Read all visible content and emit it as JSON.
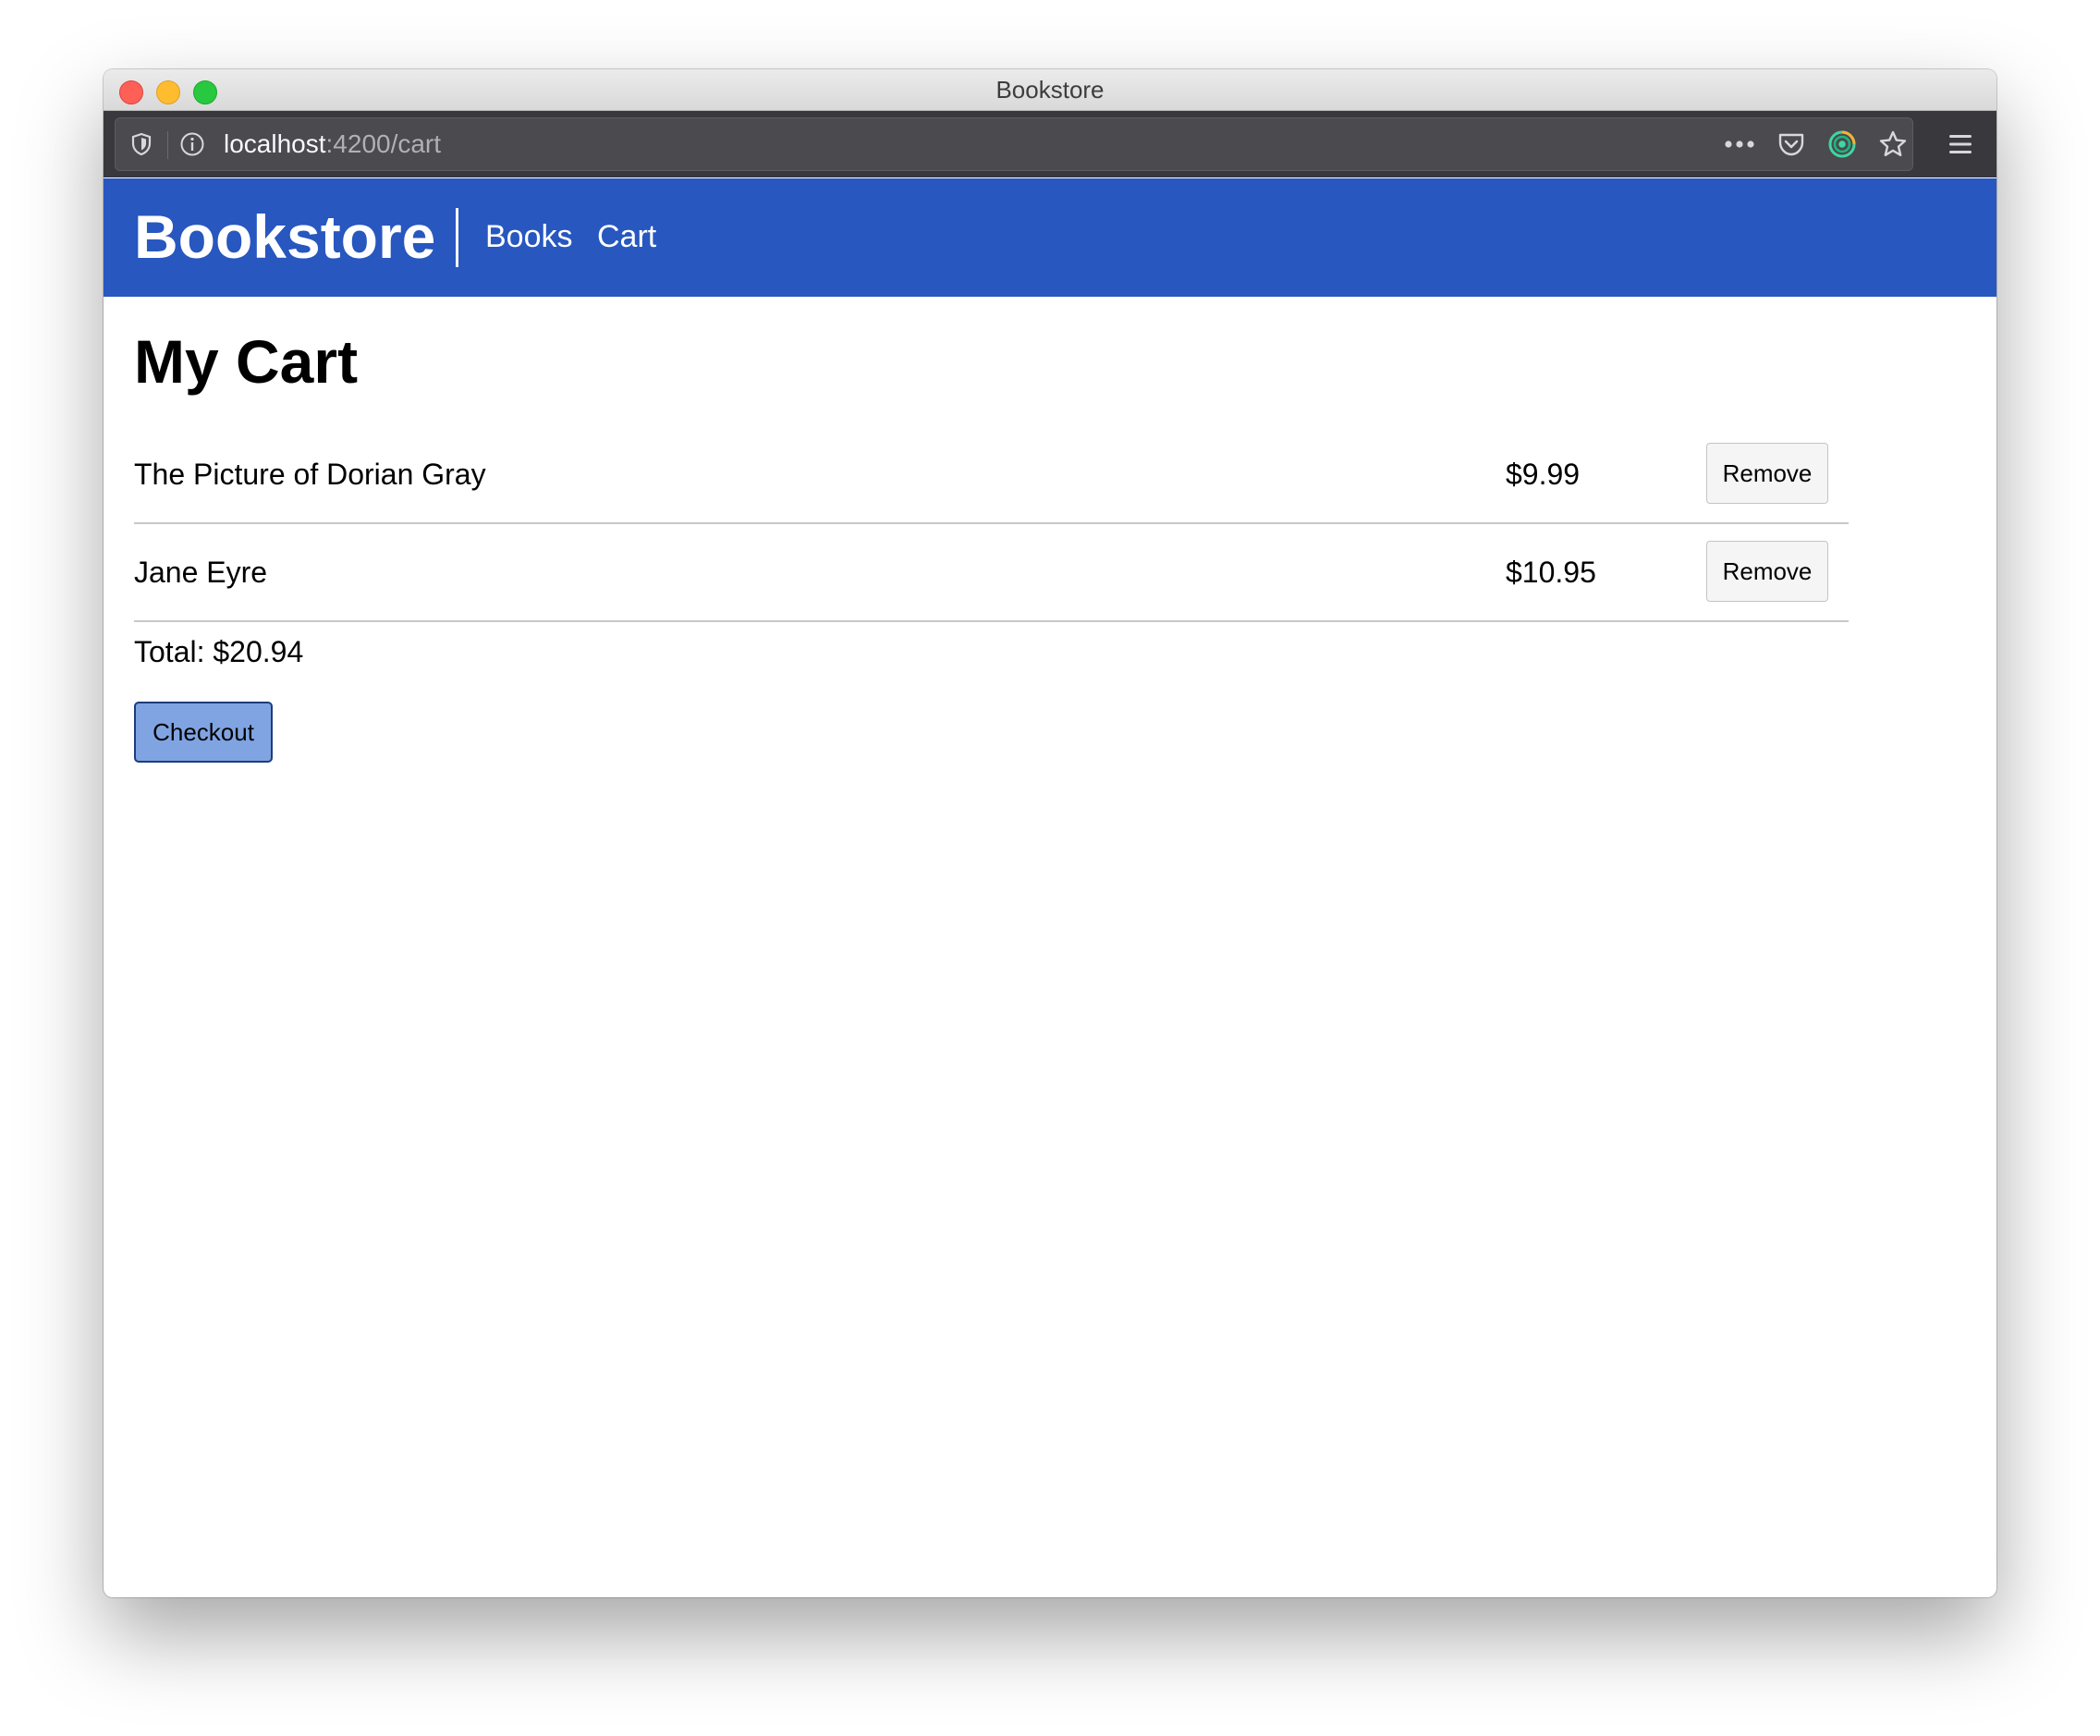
{
  "window": {
    "title": "Bookstore"
  },
  "browser": {
    "url_host": "localhost",
    "url_path": ":4200/cart",
    "icons": [
      "shield-icon",
      "info-icon",
      "more-icon",
      "pocket-icon",
      "extension-icon",
      "bookmark-star-icon",
      "menu-icon"
    ]
  },
  "nav": {
    "brand": "Bookstore",
    "links": [
      {
        "label": "Books"
      },
      {
        "label": "Cart"
      }
    ]
  },
  "cart": {
    "title": "My Cart",
    "items": [
      {
        "title": "The Picture of Dorian Gray",
        "price": "$9.99",
        "remove_label": "Remove"
      },
      {
        "title": "Jane Eyre",
        "price": "$10.95",
        "remove_label": "Remove"
      }
    ],
    "total_text": "Total: $20.94",
    "checkout_label": "Checkout"
  },
  "colors": {
    "nav_background": "#2757bf",
    "checkout_background": "#80a4e2"
  }
}
